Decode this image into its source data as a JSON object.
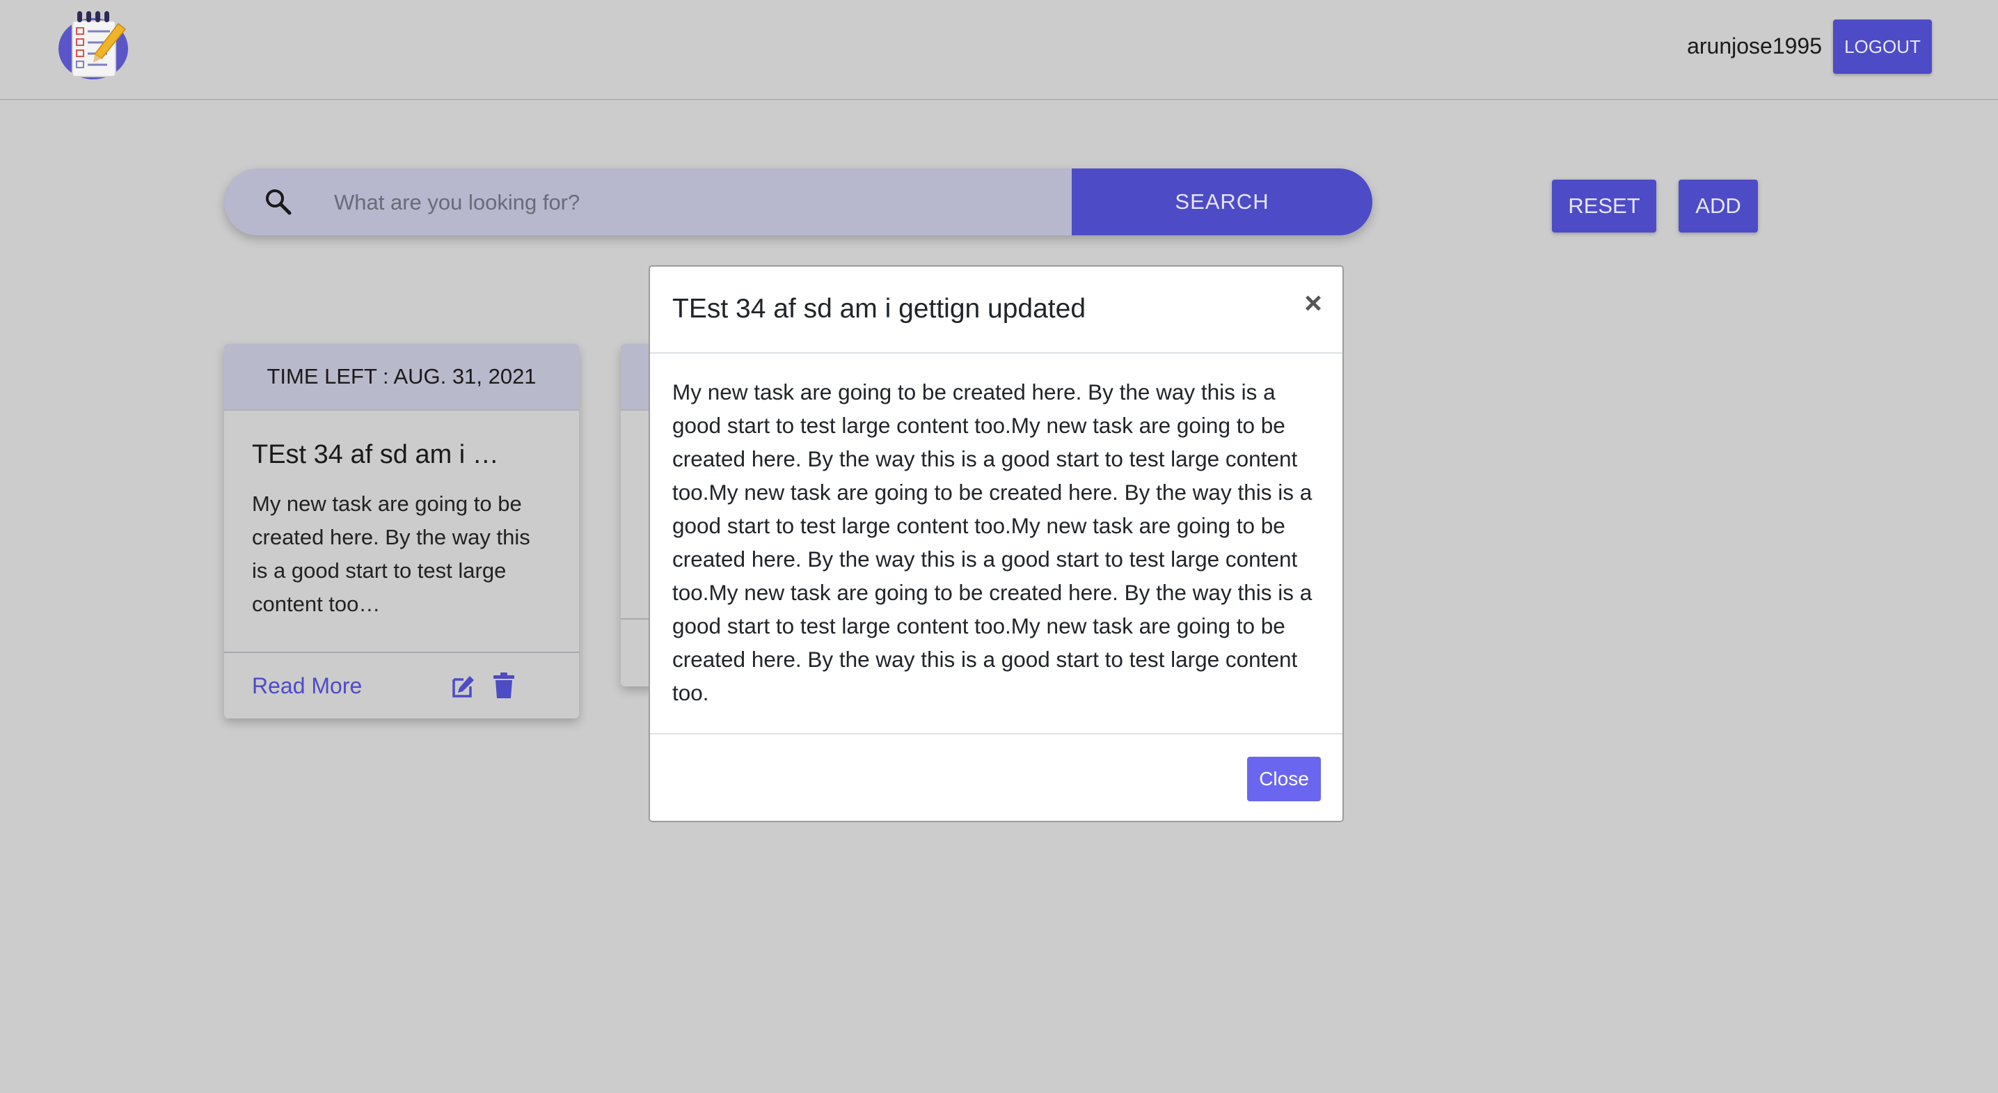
{
  "header": {
    "username": "arunjose1995",
    "logout_label": "LOGOUT",
    "logo_icon": "notepad-checklist-pencil-icon"
  },
  "search": {
    "placeholder": "What are you looking for?",
    "button_label": "SEARCH",
    "icon": "search-icon"
  },
  "actions": {
    "reset_label": "RESET",
    "add_label": "ADD"
  },
  "cards": [
    {
      "time_left": "TIME LEFT : AUG. 31, 2021",
      "title": "TEst 34 af sd am i …",
      "text": "My new task are going to be created here. By the way this is a good start to test large content too…",
      "read_more_label": "Read More",
      "edit_icon": "edit-icon",
      "delete_icon": "trash-icon"
    }
  ],
  "modal": {
    "title": "TEst 34 af sd am i gettign updated",
    "close_symbol": "×",
    "body": "My new task are going to be created here. By the way this is a good start to test large content too.My new task are going to be created here. By the way this is a good start to test large content too.My new task are going to be created here. By the way this is a good start to test large content too.My new task are going to be created here. By the way this is a good start to test large content too.My new task are going to be created here. By the way this is a good start to test large content too.My new task are going to be created here. By the way this is a good start to test large content too.",
    "close_label": "Close"
  },
  "colors": {
    "page_background": "#cccccc",
    "accent": "#4e4bc6",
    "modal_button": "#6a66f0",
    "search_bar": "#b7b7cd",
    "card_header": "#b9b9cc"
  }
}
